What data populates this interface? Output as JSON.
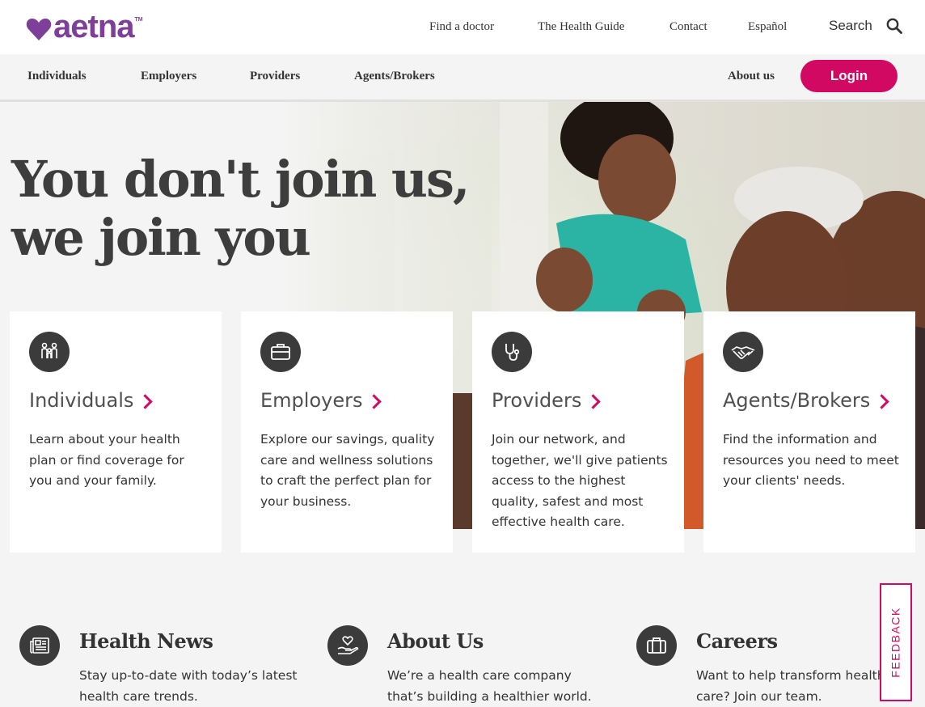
{
  "brand": {
    "name": "aetna",
    "trademark": "TM",
    "color": "#7d3f98"
  },
  "utility_nav": {
    "find_doctor": "Find a doctor",
    "health_guide": "The Health Guide",
    "contact": "Contact",
    "espanol": "Español",
    "search": "Search",
    "search_icon": "search-icon"
  },
  "main_nav": {
    "items": [
      "Individuals",
      "Employers",
      "Providers",
      "Agents/Brokers"
    ],
    "about": "About us",
    "login": "Login",
    "login_color": "#d20962"
  },
  "hero": {
    "title": "You don't join us, we join you"
  },
  "cards": [
    {
      "icon": "family-icon",
      "title": "Individuals",
      "desc": "Learn about your health plan or find coverage for you and your family."
    },
    {
      "icon": "briefcase-icon",
      "title": "Employers",
      "desc": "Explore our savings, quality care and wellness solutions to craft the perfect plan for your business."
    },
    {
      "icon": "stethoscope-icon",
      "title": "Providers",
      "desc": "Join our network, and together, we'll give patients access to the highest quality, safest and most effective health care."
    },
    {
      "icon": "handshake-icon",
      "title": "Agents/Brokers",
      "desc": "Find the information and resources you need to meet your clients' needs."
    }
  ],
  "bottom": [
    {
      "icon": "newspaper-icon",
      "title": "Health News",
      "desc": "Stay up-to-date with today’s latest health care trends."
    },
    {
      "icon": "heart-hand-icon",
      "title": "About Us",
      "desc": "We’re a health care company that’s building a healthier world."
    },
    {
      "icon": "briefcase-icon",
      "title": "Careers",
      "desc": "Want to help transform health care? Join our team."
    }
  ],
  "feedback": "FEEDBACK",
  "accent_color": "#d20962"
}
